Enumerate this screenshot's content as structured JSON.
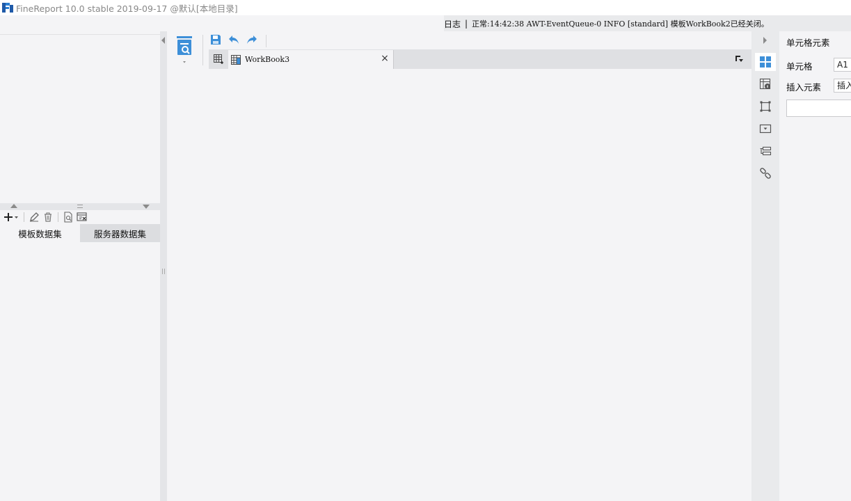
{
  "window": {
    "title": "FineReport 10.0 stable 2019-09-17 @默认[本地目录]"
  },
  "log": {
    "label": "日志",
    "separator": "|",
    "message": "正常:14:42:38 AWT-EventQueue-0 INFO [standard] 模板WorkBook2已经关闭。"
  },
  "dataset_panel": {
    "toolbar": {
      "icons": [
        "add-icon",
        "edit-icon",
        "delete-icon",
        "preview-icon",
        "table-properties-icon"
      ]
    },
    "tabs": [
      {
        "label": "模板数据集",
        "active": true
      },
      {
        "label": "服务器数据集",
        "active": false
      }
    ]
  },
  "editor": {
    "toolbar_icons": [
      "template-preview-icon",
      "save-icon",
      "undo-icon",
      "redo-icon"
    ],
    "tabs": [
      {
        "label": "WorkBook3",
        "close": "×"
      }
    ]
  },
  "right_strip": {
    "icons": [
      {
        "name": "cell-element-icon",
        "active": true
      },
      {
        "name": "cell-attributes-icon",
        "active": false
      },
      {
        "name": "float-element-icon",
        "active": false
      },
      {
        "name": "widget-settings-icon",
        "active": false
      },
      {
        "name": "condition-attributes-icon",
        "active": false
      },
      {
        "name": "hyperlink-icon",
        "active": false
      }
    ]
  },
  "right_panel": {
    "title": "单元格元素",
    "cell_label": "单元格",
    "cell_value": "A1",
    "insert_label": "插入元素",
    "insert_value": "插入"
  },
  "colors": {
    "accent": "#3d8fd8",
    "background": "#f4f4f6",
    "strip": "#e9eaec"
  }
}
